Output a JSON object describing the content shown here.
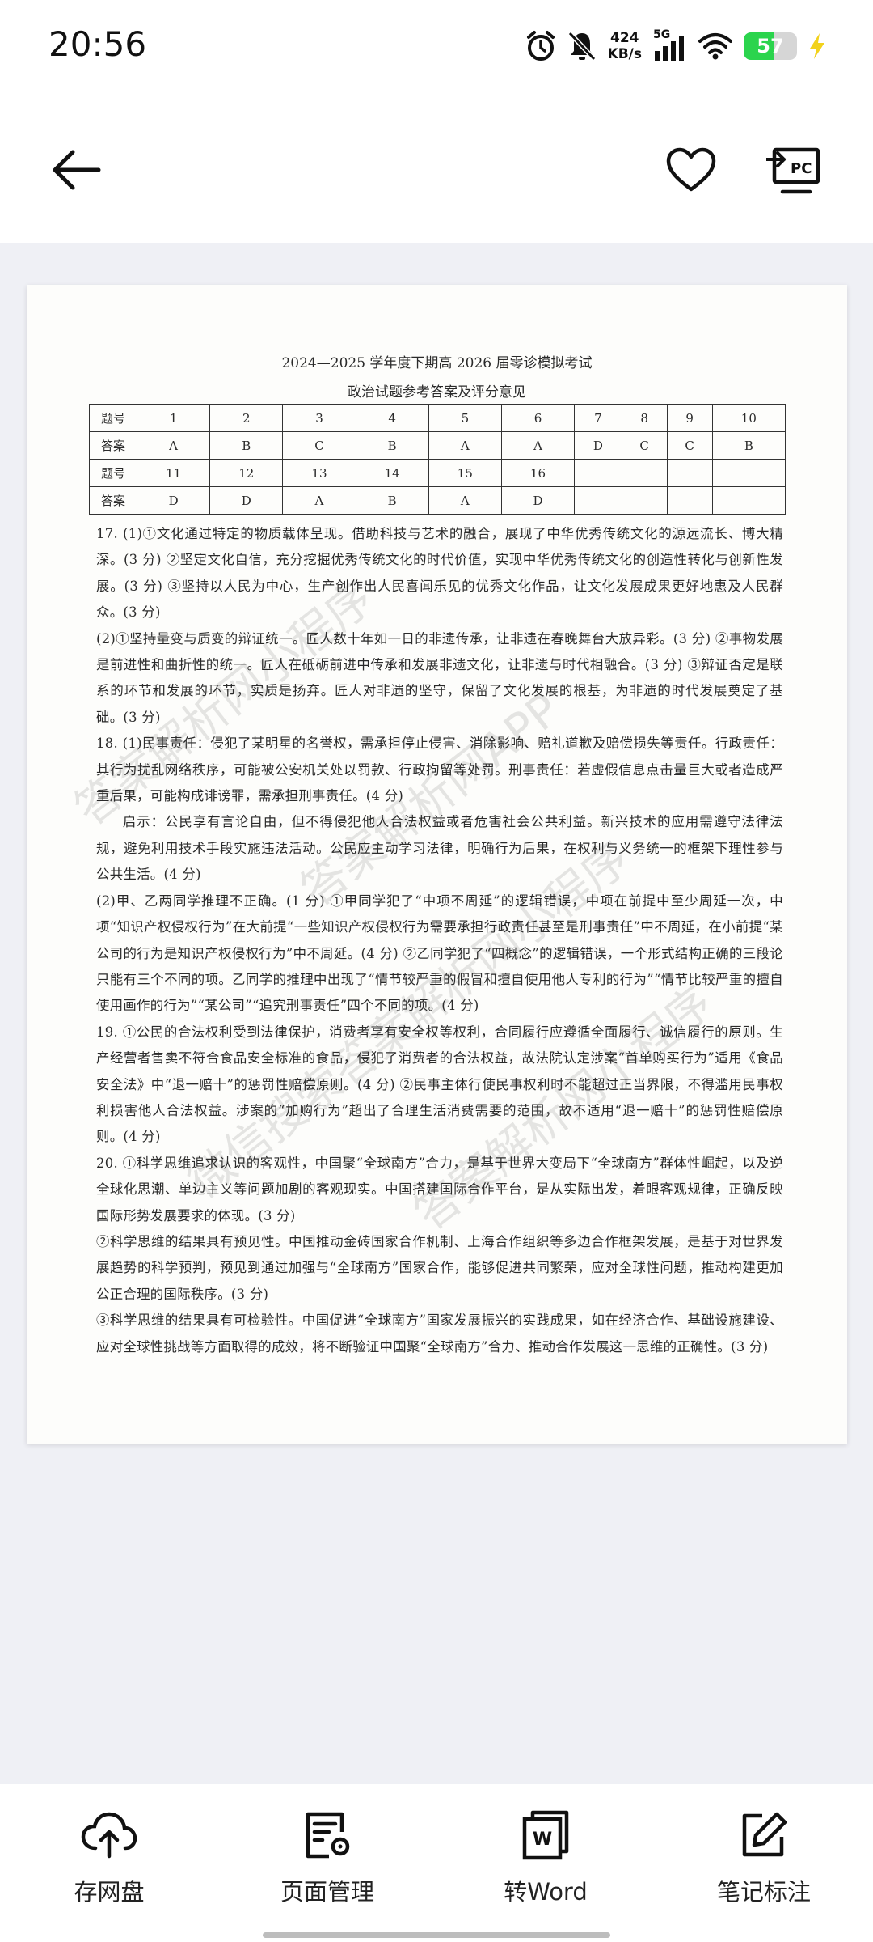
{
  "status": {
    "time": "20:56",
    "speed_value": "424",
    "speed_unit": "KB/s",
    "network": "5G",
    "battery": "57",
    "battery_fill_percent": 57,
    "battery_color": "#2bd44d",
    "charging_color": "#f2d21b"
  },
  "toolbar": {
    "back_icon": "arrow-left-icon",
    "favorite_icon": "heart-icon",
    "cast_icon": "cast-to-pc-icon",
    "cast_label": "PC"
  },
  "document": {
    "title": "2024—2025 学年度下期高 2026 届零诊模拟考试",
    "subtitle": "政治试题参考答案及评分意见",
    "table": [
      [
        "题号",
        "1",
        "2",
        "3",
        "4",
        "5",
        "6",
        "7",
        "8",
        "9",
        "10"
      ],
      [
        "答案",
        "A",
        "B",
        "C",
        "B",
        "A",
        "A",
        "D",
        "C",
        "C",
        "B"
      ],
      [
        "题号",
        "11",
        "12",
        "13",
        "14",
        "15",
        "16",
        "",
        "",
        "",
        ""
      ],
      [
        "答案",
        "D",
        "D",
        "A",
        "B",
        "A",
        "D",
        "",
        "",
        "",
        ""
      ]
    ],
    "paragraphs": [
      "17. (1)①文化通过特定的物质载体呈现。借助科技与艺术的融合，展现了中华优秀传统文化的源远流长、博大精深。(3 分) ②坚定文化自信，充分挖掘优秀传统文化的时代价值，实现中华优秀传统文化的创造性转化与创新性发展。(3 分) ③坚持以人民为中心，生产创作出人民喜闻乐见的优秀文化作品，让文化发展成果更好地惠及人民群众。(3 分)",
      "(2)①坚持量变与质变的辩证统一。匠人数十年如一日的非遗传承，让非遗在春晚舞台大放异彩。(3 分) ②事物发展是前进性和曲折性的统一。匠人在砥砺前进中传承和发展非遗文化，让非遗与时代相融合。(3 分) ③辩证否定是联系的环节和发展的环节，实质是扬弃。匠人对非遗的坚守，保留了文化发展的根基，为非遗的时代发展奠定了基础。(3 分)",
      "18. (1)民事责任：侵犯了某明星的名誉权，需承担停止侵害、消除影响、赔礼道歉及赔偿损失等责任。行政责任：其行为扰乱网络秩序，可能被公安机关处以罚款、行政拘留等处罚。刑事责任：若虚假信息点击量巨大或者造成严重后果，可能构成诽谤罪，需承担刑事责任。(4 分)",
      "启示：公民享有言论自由，但不得侵犯他人合法权益或者危害社会公共利益。新兴技术的应用需遵守法律法规，避免利用技术手段实施违法活动。公民应主动学习法律，明确行为后果，在权利与义务统一的框架下理性参与公共生活。(4 分)",
      "(2)甲、乙两同学推理不正确。(1 分) ①甲同学犯了“中项不周延”的逻辑错误，中项在前提中至少周延一次，中项“知识产权侵权行为”在大前提“一些知识产权侵权行为需要承担行政责任甚至是刑事责任”中不周延，在小前提“某公司的行为是知识产权侵权行为”中不周延。(4 分) ②乙同学犯了“四概念”的逻辑错误，一个形式结构正确的三段论只能有三个不同的项。乙同学的推理中出现了“情节较严重的假冒和擅自使用他人专利的行为”“情节比较严重的擅自使用画作的行为”“某公司”“追究刑事责任”四个不同的项。(4 分)",
      "19. ①公民的合法权利受到法律保护，消费者享有安全权等权利，合同履行应遵循全面履行、诚信履行的原则。生产经营者售卖不符合食品安全标准的食品，侵犯了消费者的合法权益，故法院认定涉案“首单购买行为”适用《食品安全法》中“退一赔十”的惩罚性赔偿原则。(4 分) ②民事主体行使民事权利时不能超过正当界限，不得滥用民事权利损害他人合法权益。涉案的“加购行为”超出了合理生活消费需要的范围，故不适用“退一赔十”的惩罚性赔偿原则。(4 分)",
      "20. ①科学思维追求认识的客观性，中国聚“全球南方”合力，是基于世界大变局下“全球南方”群体性崛起，以及逆全球化思潮、单边主义等问题加剧的客观现实。中国搭建国际合作平台，是从实际出发，着眼客观规律，正确反映国际形势发展要求的体现。(3 分)",
      "②科学思维的结果具有预见性。中国推动金砖国家合作机制、上海合作组织等多边合作框架发展，是基于对世界发展趋势的科学预判，预见到通过加强与“全球南方”国家合作，能够促进共同繁荣，应对全球性问题，推动构建更加公正合理的国际秩序。(3 分)",
      "③科学思维的结果具有可检验性。中国促进“全球南方”国家发展振兴的实践成果，如在经济合作、基础设施建设、应对全球性挑战等方面取得的成效，将不断验证中国聚“全球南方”合力、推动合作发展这一思维的正确性。(3 分)"
    ],
    "watermarks": [
      "答案解析网小程序",
      "答案解析网APP",
      "微信搜索答案解析网小程序",
      "答案解析网小程序"
    ]
  },
  "bottom_bar": [
    {
      "label": "存网盘",
      "icon": "cloud-upload-icon"
    },
    {
      "label": "页面管理",
      "icon": "page-manage-icon"
    },
    {
      "label": "转Word",
      "icon": "word-convert-icon"
    },
    {
      "label": "笔记标注",
      "icon": "edit-note-icon"
    }
  ]
}
